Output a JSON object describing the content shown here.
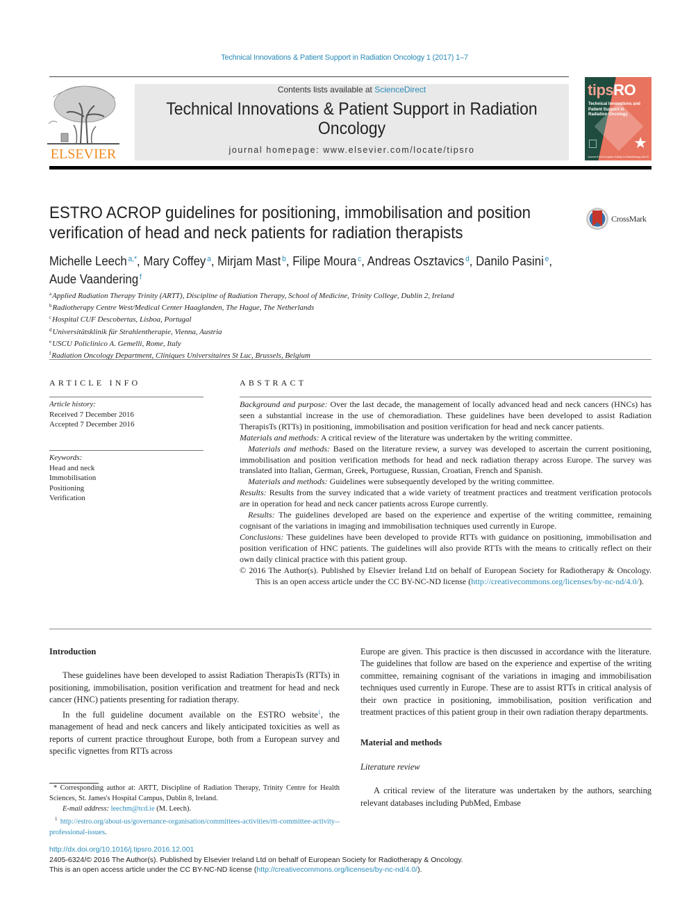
{
  "running_head": "Technical Innovations & Patient Support in Radiation Oncology 1 (2017) 1–7",
  "masthead": {
    "contents_prefix": "Contents lists available at ",
    "contents_link": "ScienceDirect",
    "journal_title": "Technical Innovations & Patient Support in Radiation Oncology",
    "homepage": "journal homepage: www.elsevier.com/locate/tipsro",
    "publisher_logo": "ELSEVIER"
  },
  "cover": {
    "brand_prefix": "tips",
    "brand_suffix": "RO",
    "subtitle": "Technical Innovations and Patient Support in Radiation Oncology",
    "footer": "Journal of the European Society for Radiotherapy and Oncology",
    "colors": {
      "green": "#1f4c3e",
      "salmon": "#e8735f"
    }
  },
  "article": {
    "title": "ESTRO ACROP guidelines for positioning, immobilisation and position verification of head and neck patients for radiation therapists",
    "crossmark_label": "CrossMark",
    "authors": [
      {
        "name": "Michelle Leech",
        "sup": "a,*",
        "sep": ", "
      },
      {
        "name": "Mary Coffey",
        "sup": "a",
        "sep": ", "
      },
      {
        "name": "Mirjam Mast",
        "sup": "b",
        "sep": ", "
      },
      {
        "name": "Filipe Moura",
        "sup": "c",
        "sep": ", "
      },
      {
        "name": "Andreas Osztavics",
        "sup": "d",
        "sep": ", "
      },
      {
        "name": "Danilo Pasini",
        "sup": "e",
        "sep": ","
      },
      {
        "name": "Aude Vaandering",
        "sup": "f",
        "sep": ""
      }
    ],
    "affiliations": [
      {
        "key": "a",
        "text": "Applied Radiation Therapy Trinity (ARTT), Discipline of Radiation Therapy, School of Medicine, Trinity College, Dublin 2, Ireland"
      },
      {
        "key": "b",
        "text": "Radiotherapy Centre West/Medical Center Haaglanden, The Hague, The Netherlands"
      },
      {
        "key": "c",
        "text": "Hospital CUF Descobertas, Lisboa, Portugal"
      },
      {
        "key": "d",
        "text": "Universitätsklinik für Strahlentherapie, Vienna, Austria"
      },
      {
        "key": "e",
        "text": "USCU Policlinico A. Gemelli, Rome, Italy"
      },
      {
        "key": "f",
        "text": "Radiation Oncology Department, Cliniques Universitaires St Luc, Brussels, Belgium"
      }
    ]
  },
  "article_info": {
    "heading": "ARTICLE INFO",
    "history_label": "Article history:",
    "received": "Received 7 December 2016",
    "accepted": "Accepted 7 December 2016",
    "keywords_label": "Keywords:",
    "keywords": [
      "Head and neck",
      "Immobilisation",
      "Positioning",
      "Verification"
    ]
  },
  "abstract": {
    "heading": "ABSTRACT",
    "paragraphs": [
      {
        "label": "Background and purpose:",
        "text": " Over the last decade, the management of locally advanced head and neck cancers (HNCs) has seen a substantial increase in the use of chemoradiation. These guidelines have been developed to assist Radiation TherapisTs (RTTs) in positioning, immobilisation and position verification for head and neck cancer patients.",
        "indent": false
      },
      {
        "label": "Materials and methods:",
        "text": " A critical review of the literature was undertaken by the writing committee.",
        "indent": false
      },
      {
        "label": "Materials and methods:",
        "text": " Based on the literature review, a survey was developed to ascertain the current positioning, immobilisation and position verification methods for head and neck radiation therapy across Europe. The survey was translated into Italian, German, Greek, Portuguese, Russian, Croatian, French and Spanish.",
        "indent": true
      },
      {
        "label": "Materials and methods:",
        "text": " Guidelines were subsequently developed by the writing committee.",
        "indent": true
      },
      {
        "label": "Results:",
        "text": " Results from the survey indicated that a wide variety of treatment practices and treatment verification protocols are in operation for head and neck cancer patients across Europe currently.",
        "indent": false
      },
      {
        "label": "Results:",
        "text": " The guidelines developed are based on the experience and expertise of the writing committee, remaining cognisant of the variations in imaging and immobilisation techniques used currently in Europe.",
        "indent": true
      },
      {
        "label": "Conclusions:",
        "text": " These guidelines have been developed to provide RTTs with guidance on positioning, immobilisation and position verification of HNC patients. The guidelines will also provide RTTs with the means to critically reflect on their own daily clinical practice with this patient group.",
        "indent": false
      }
    ],
    "copyright": "© 2016 The Author(s). Published by Elsevier Ireland Ltd on behalf of European Society for Radiotherapy & Oncology. This is an open access article under the CC BY-NC-ND license (",
    "license_link": "http://creativecommons.org/licenses/by-nc-nd/4.0/",
    "copyright_end": ")."
  },
  "body": {
    "intro_heading": "Introduction",
    "intro_p1": "These guidelines have been developed to assist Radiation TherapisTs (RTTs) in positioning, immobilisation, position verification and treatment for head and neck cancer (HNC) patients presenting for radiation therapy.",
    "intro_p2_start": "In the full guideline document available on the ESTRO website",
    "intro_p2_fnref": "1",
    "intro_p2_rest": ", the management of head and neck cancers and likely anticipated toxicities as well as reports of current practice throughout Europe, both from a European survey and specific vignettes from RTTs across",
    "right_p1": "Europe are given. This practice is then discussed in accordance with the literature. The guidelines that follow are based on the experience and expertise of the writing committee, remaining cognisant of the variations in imaging and immobilisation techniques used currently in Europe. These are to assist RTTs in critical analysis of their own practice in positioning, immobilisation, position verification and treatment practices of this patient group in their own radiation therapy departments.",
    "methods_heading": "Material and methods",
    "lit_review_heading": "Literature review",
    "lit_review_p1": "A critical review of the literature was undertaken by the authors, searching relevant databases including PubMed, Embase"
  },
  "footnotes": {
    "corresponding_marker": "*",
    "corresponding": " Corresponding author at: ARTT, Discipline of Radiation Therapy, Trinity Centre for Health Sciences, St. James's Hospital Campus, Dublin 8, Ireland.",
    "email_label": "E-mail address:",
    "email": "leechm@tcd.ie",
    "email_suffix": " (M. Leech).",
    "fn1_marker": "1",
    "fn1_link": "http://estro.org/about-us/governance-organisation/committees-activities/rtt-committee-activity--professional-issues",
    "fn1_end": "."
  },
  "bottom": {
    "doi": "http://dx.doi.org/10.1016/j.tipsro.2016.12.001",
    "issn_line": "2405-6324/© 2016 The Author(s). Published by Elsevier Ireland Ltd on behalf of European Society for Radiotherapy & Oncology.",
    "oa_prefix": "This is an open access article under the CC BY-NC-ND license (",
    "oa_link": "http://creativecommons.org/licenses/by-nc-nd/4.0/",
    "oa_end": ")."
  },
  "colors": {
    "link": "#2a8bb8",
    "elsevier_orange": "#f08a1e",
    "masthead_bg": "#e9e9e9"
  }
}
